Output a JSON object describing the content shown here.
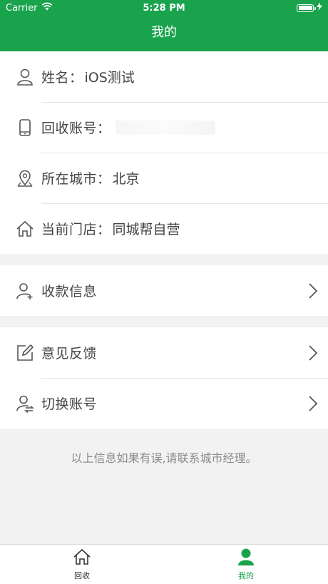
{
  "status_bar": {
    "carrier": "Carrier",
    "time": "5:28 PM",
    "battery_level": 1.0
  },
  "nav": {
    "title": "我的"
  },
  "profile": [
    {
      "icon": "person-icon",
      "label": "姓名：",
      "value": "iOS测试"
    },
    {
      "icon": "phone-icon",
      "label": "回收账号：",
      "value": ""
    },
    {
      "icon": "location-pin-icon",
      "label": "所在城市：",
      "value": "北京"
    },
    {
      "icon": "home-icon",
      "label": "当前门店：",
      "value": "同城帮自营"
    }
  ],
  "menu1": [
    {
      "icon": "person-add-icon",
      "label": "收款信息"
    }
  ],
  "menu2": [
    {
      "icon": "edit-icon",
      "label": "意见反馈"
    },
    {
      "icon": "switch-user-icon",
      "label": "切换账号"
    }
  ],
  "notice": "以上信息如果有误,请联系城市经理。",
  "tabbar": {
    "tabs": [
      {
        "label": "回收",
        "icon": "home-icon"
      },
      {
        "label": "我的",
        "icon": "person-icon"
      }
    ],
    "active_color": "#19a34d"
  },
  "colors": {
    "brand": "#19a34d"
  }
}
